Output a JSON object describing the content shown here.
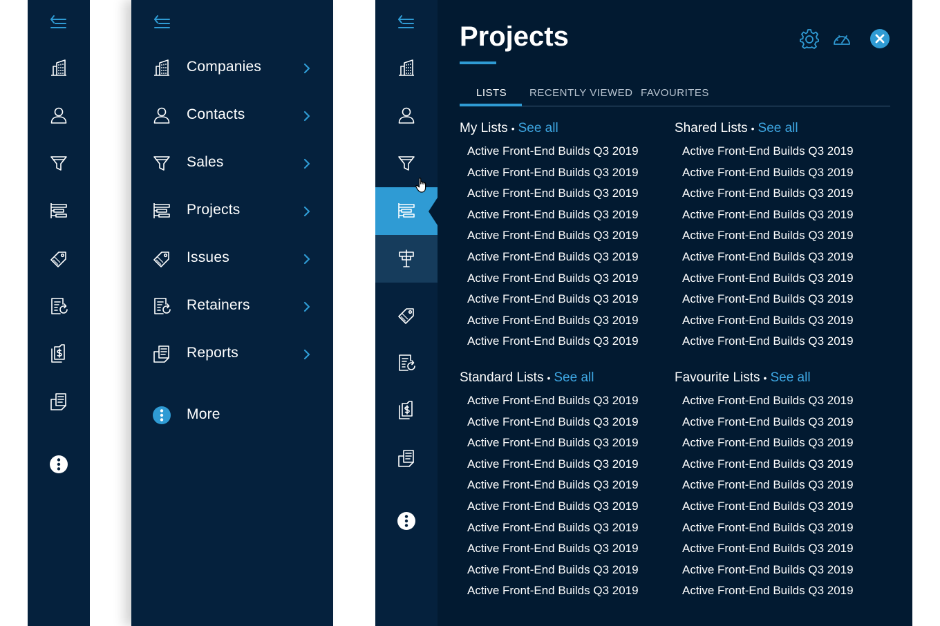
{
  "sidebar_collapsed": {
    "icons": [
      "collapse-menu-icon",
      "companies-icon",
      "contacts-icon",
      "sales-icon",
      "projects-icon",
      "issues-icon",
      "retainers-icon",
      "reports-icon",
      "documents-icon",
      "more-icon"
    ]
  },
  "sidebar_expanded": {
    "items": [
      {
        "label": "Companies",
        "icon": "companies-icon"
      },
      {
        "label": "Contacts",
        "icon": "contacts-icon"
      },
      {
        "label": "Sales",
        "icon": "sales-icon"
      },
      {
        "label": "Projects",
        "icon": "projects-icon"
      },
      {
        "label": "Issues",
        "icon": "issues-icon"
      },
      {
        "label": "Retainers",
        "icon": "retainers-icon"
      },
      {
        "label": "Reports",
        "icon": "reports-icon"
      }
    ],
    "more_label": "More"
  },
  "projects_panel": {
    "title": "Projects",
    "tabs": [
      "LISTS",
      "RECENTLY VIEWED",
      "FAVOURITES"
    ],
    "active_tab": "LISTS",
    "separator": "•",
    "see_all": "See all",
    "sections": [
      {
        "title": "My Lists",
        "items": [
          "Active Front-End Builds Q3 2019",
          "Active Front-End Builds Q3 2019",
          "Active Front-End Builds Q3 2019",
          "Active Front-End Builds Q3 2019",
          "Active Front-End Builds Q3 2019",
          "Active Front-End Builds Q3 2019",
          "Active Front-End Builds Q3 2019",
          "Active Front-End Builds Q3 2019",
          "Active Front-End Builds Q3 2019",
          "Active Front-End Builds Q3 2019"
        ]
      },
      {
        "title": "Shared Lists",
        "items": [
          "Active Front-End Builds Q3 2019",
          "Active Front-End Builds Q3 2019",
          "Active Front-End Builds Q3 2019",
          "Active Front-End Builds Q3 2019",
          "Active Front-End Builds Q3 2019",
          "Active Front-End Builds Q3 2019",
          "Active Front-End Builds Q3 2019",
          "Active Front-End Builds Q3 2019",
          "Active Front-End Builds Q3 2019",
          "Active Front-End Builds Q3 2019"
        ]
      },
      {
        "title": "Standard Lists",
        "items": [
          "Active Front-End Builds Q3 2019",
          "Active Front-End Builds Q3 2019",
          "Active Front-End Builds Q3 2019",
          "Active Front-End Builds Q3 2019",
          "Active Front-End Builds Q3 2019",
          "Active Front-End Builds Q3 2019",
          "Active Front-End Builds Q3 2019",
          "Active Front-End Builds Q3 2019",
          "Active Front-End Builds Q3 2019",
          "Active Front-End Builds Q3 2019"
        ]
      },
      {
        "title": "Favourite Lists",
        "items": [
          "Active Front-End Builds Q3 2019",
          "Active Front-End Builds Q3 2019",
          "Active Front-End Builds Q3 2019",
          "Active Front-End Builds Q3 2019",
          "Active Front-End Builds Q3 2019",
          "Active Front-End Builds Q3 2019",
          "Active Front-End Builds Q3 2019",
          "Active Front-End Builds Q3 2019",
          "Active Front-End Builds Q3 2019",
          "Active Front-End Builds Q3 2019"
        ]
      }
    ]
  },
  "colors": {
    "sidebar_bg": "#05213d",
    "panel_bg": "#021a31",
    "accent": "#2f9bd4",
    "link": "#3ea7e3",
    "submenu_bg": "#163c5c"
  }
}
